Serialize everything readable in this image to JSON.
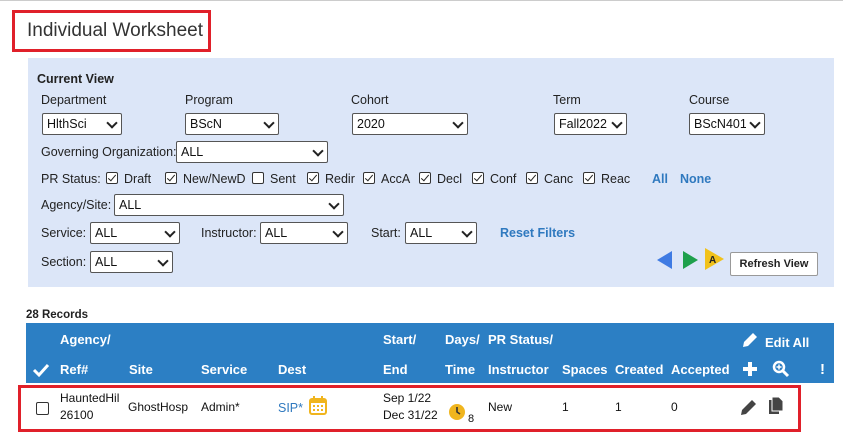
{
  "page": {
    "title": "Individual Worksheet"
  },
  "filters": {
    "heading": "Current View",
    "department": {
      "label": "Department",
      "value": "HlthSci"
    },
    "program": {
      "label": "Program",
      "value": "BScN"
    },
    "cohort": {
      "label": "Cohort",
      "value": "2020"
    },
    "term": {
      "label": "Term",
      "value": "Fall2022"
    },
    "course": {
      "label": "Course",
      "value": "BScN401"
    },
    "governing_org": {
      "label": "Governing Organization:",
      "value": "ALL"
    },
    "pr_status": {
      "label": "PR Status:",
      "options": [
        {
          "label": "Draft",
          "checked": true
        },
        {
          "label": "New/NewD",
          "checked": true
        },
        {
          "label": "Sent",
          "checked": false
        },
        {
          "label": "Redir",
          "checked": true
        },
        {
          "label": "AccA",
          "checked": true
        },
        {
          "label": "Decl",
          "checked": true
        },
        {
          "label": "Conf",
          "checked": true
        },
        {
          "label": "Canc",
          "checked": true
        },
        {
          "label": "Reac",
          "checked": true
        }
      ],
      "all_link": "All",
      "none_link": "None"
    },
    "agency_site": {
      "label": "Agency/Site:",
      "value": "ALL"
    },
    "service": {
      "label": "Service:",
      "value": "ALL"
    },
    "instructor": {
      "label": "Instructor:",
      "value": "ALL"
    },
    "start": {
      "label": "Start:",
      "value": "ALL"
    },
    "reset_link": "Reset Filters",
    "section": {
      "label": "Section:",
      "value": "ALL"
    },
    "refresh_button": "Refresh View"
  },
  "records_count": "28 Records",
  "table": {
    "headers": {
      "agency": "Agency/",
      "ref": "Ref#",
      "site": "Site",
      "service": "Service",
      "dest": "Dest",
      "start": "Start/",
      "end": "End",
      "days": "Days/",
      "time": "Time",
      "pr_status": "PR Status/",
      "instructor": "Instructor",
      "spaces": "Spaces",
      "created": "Created",
      "accepted": "Accepted",
      "edit_all": "Edit All",
      "exclaim": "!"
    },
    "rows": [
      {
        "agency": "HauntedHil",
        "ref": "26100",
        "site": "GhostHosp",
        "service": "Admin*",
        "dest": "SIP*",
        "start": "Sep 1/22",
        "end": "Dec 31/22",
        "days": "8",
        "status": "New",
        "spaces": "1",
        "created": "1",
        "accepted": "0"
      }
    ]
  },
  "colors": {
    "accent": "#2c7fc4",
    "highlight": "#e0202a",
    "panel": "#dce6f8"
  }
}
